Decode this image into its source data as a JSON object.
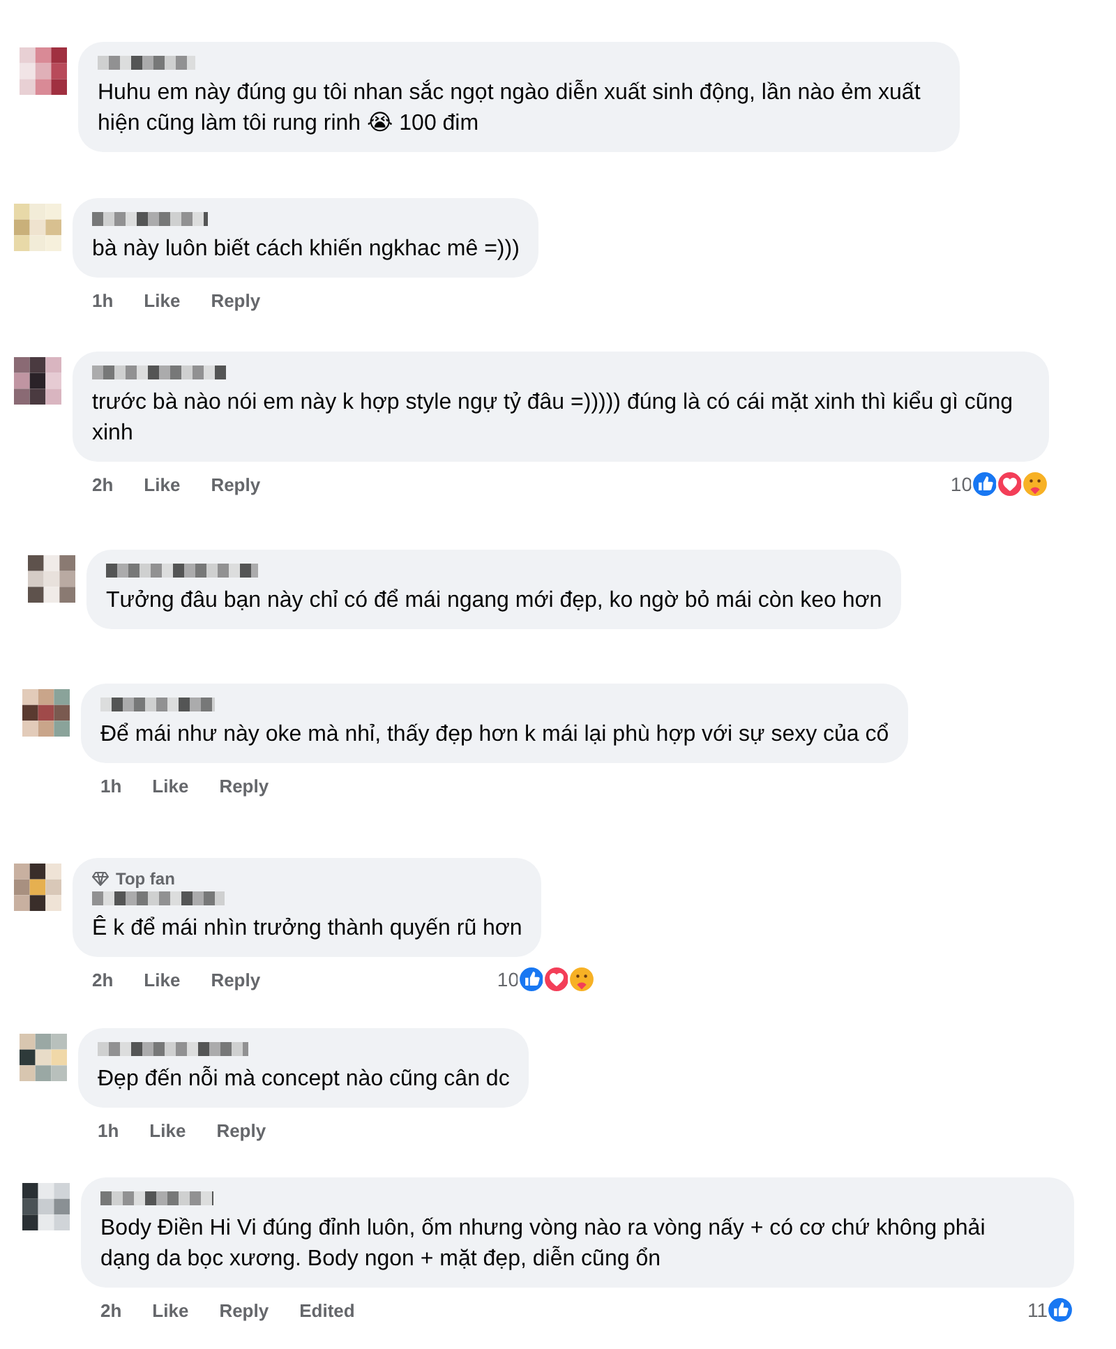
{
  "comments": [
    {
      "text": "Huhu em này đúng gu tôi  nhan sắc ngọt ngào diễn xuất sinh động, lần nào ẻm xuất hiện cũng làm tôi rung rinh 😭 100 đim"
    },
    {
      "text": "bà này luôn biết cách khiến ngkhac mê =)))",
      "actions": {
        "time": "1h",
        "like": "Like",
        "reply": "Reply"
      }
    },
    {
      "text": "trước bà nào nói em này k hợp style ngự tỷ đâu =))))) đúng là có cái mặt xinh thì kiểu gì cũng xinh",
      "actions": {
        "time": "2h",
        "like": "Like",
        "reply": "Reply"
      },
      "reactions": {
        "count": "10",
        "types": [
          {
            "kind": "like"
          },
          {
            "kind": "love"
          },
          {
            "kind": "care"
          }
        ]
      }
    },
    {
      "text": "Tưởng đâu bạn này chỉ có để mái ngang mới đẹp, ko ngờ bỏ mái còn keo hơn"
    },
    {
      "text": "Để mái như này oke mà nhỉ, thấy đẹp hơn k mái lại phù hợp với sự sexy của cổ",
      "actions": {
        "time": "1h",
        "like": "Like",
        "reply": "Reply"
      }
    },
    {
      "badge": "Top fan",
      "text": "Ê k để mái nhìn trưởng thành quyến rũ hơn",
      "actions": {
        "time": "2h",
        "like": "Like",
        "reply": "Reply"
      },
      "reactions": {
        "count": "10",
        "types": [
          {
            "kind": "like"
          },
          {
            "kind": "love"
          },
          {
            "kind": "care"
          }
        ]
      }
    },
    {
      "text": "Đẹp đến nỗi mà concept nào cũng cân dc",
      "actions": {
        "time": "1h",
        "like": "Like",
        "reply": "Reply"
      }
    },
    {
      "text": "Body Điền Hi Vi đúng đỉnh luôn, ốm nhưng vòng nào ra vòng nấy + có cơ chứ không phải dạng da bọc xương. Body ngon + mặt đẹp, diễn cũng ổn",
      "actions": {
        "time": "2h",
        "like": "Like",
        "reply": "Reply",
        "edited": "Edited"
      },
      "reactions": {
        "count": "11",
        "types": [
          {
            "kind": "like"
          }
        ]
      }
    }
  ]
}
